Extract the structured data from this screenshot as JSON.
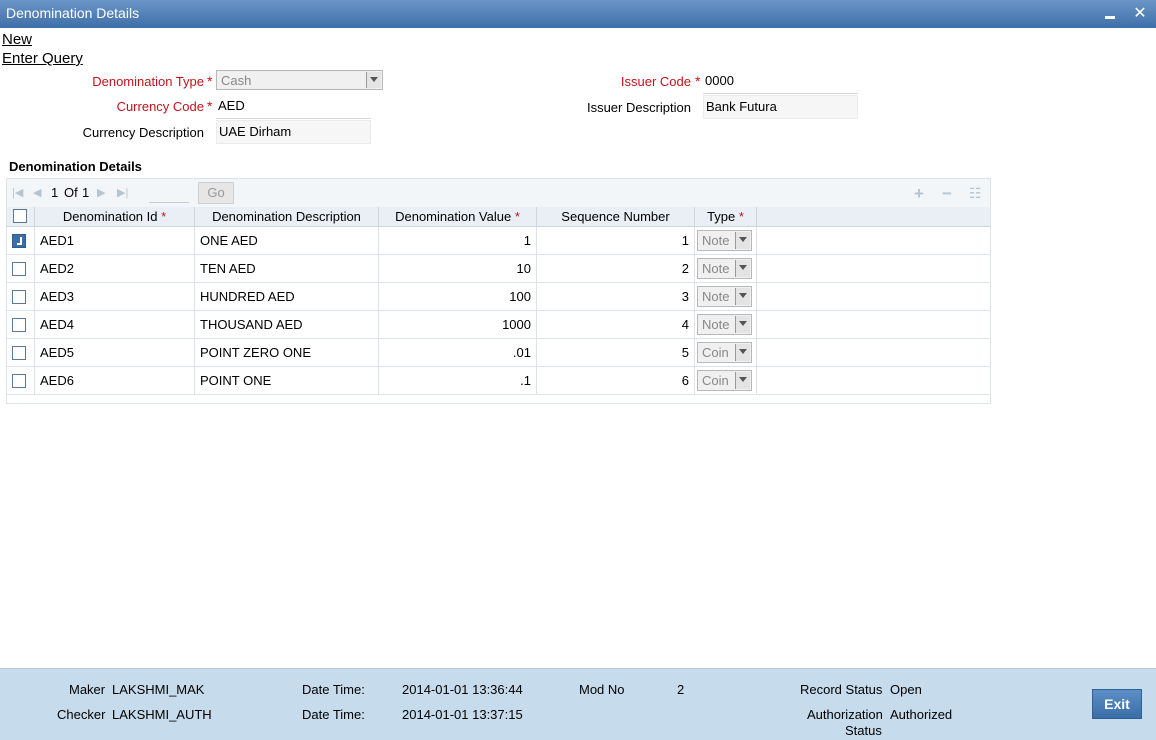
{
  "window": {
    "title": "Denomination Details"
  },
  "links": {
    "new": "New",
    "enter_query": "Enter Query"
  },
  "form": {
    "denomination_type": {
      "label": "Denomination Type",
      "value": "Cash"
    },
    "currency_code": {
      "label": "Currency Code",
      "value": "AED"
    },
    "currency_description": {
      "label": "Currency Description",
      "value": "UAE Dirham"
    },
    "issuer_code": {
      "label": "Issuer Code",
      "value": "0000"
    },
    "issuer_description": {
      "label": "Issuer Description",
      "value": "Bank Futura"
    }
  },
  "grid": {
    "section_title": "Denomination Details",
    "pager": {
      "current": "1",
      "of_label": "Of",
      "total": "1",
      "go_label": "Go"
    },
    "columns": [
      "Denomination Id",
      "Denomination Description",
      "Denomination Value",
      "Sequence Number",
      "Type"
    ],
    "rows": [
      {
        "id": "AED1",
        "description": "ONE AED",
        "value": "1",
        "sequence": "1",
        "type": "Note",
        "checked": true
      },
      {
        "id": "AED2",
        "description": "TEN AED",
        "value": "10",
        "sequence": "2",
        "type": "Note",
        "checked": false
      },
      {
        "id": "AED3",
        "description": "HUNDRED AED",
        "value": "100",
        "sequence": "3",
        "type": "Note",
        "checked": false
      },
      {
        "id": "AED4",
        "description": "THOUSAND AED",
        "value": "1000",
        "sequence": "4",
        "type": "Note",
        "checked": false
      },
      {
        "id": "AED5",
        "description": "POINT ZERO ONE",
        "value": ".01",
        "sequence": "5",
        "type": "Coin",
        "checked": false
      },
      {
        "id": "AED6",
        "description": "POINT ONE",
        "value": ".1",
        "sequence": "6",
        "type": "Coin",
        "checked": false
      }
    ]
  },
  "footer": {
    "maker_label": "Maker",
    "maker": "LAKSHMI_MAK",
    "checker_label": "Checker",
    "checker": "LAKSHMI_AUTH",
    "date_time_label": "Date Time:",
    "maker_date": "2014-01-01 13:36:44",
    "checker_date": "2014-01-01 13:37:15",
    "mod_no_label": "Mod No",
    "mod_no": "2",
    "record_status_label": "Record Status",
    "record_status": "Open",
    "auth_status_label_1": "Authorization",
    "auth_status_label_2": "Status",
    "auth_status": "Authorized",
    "exit_label": "Exit"
  },
  "colors": {
    "title_bar": "#3f6fa8",
    "required": "#c0141c",
    "footer_bg": "#c6dbec"
  }
}
